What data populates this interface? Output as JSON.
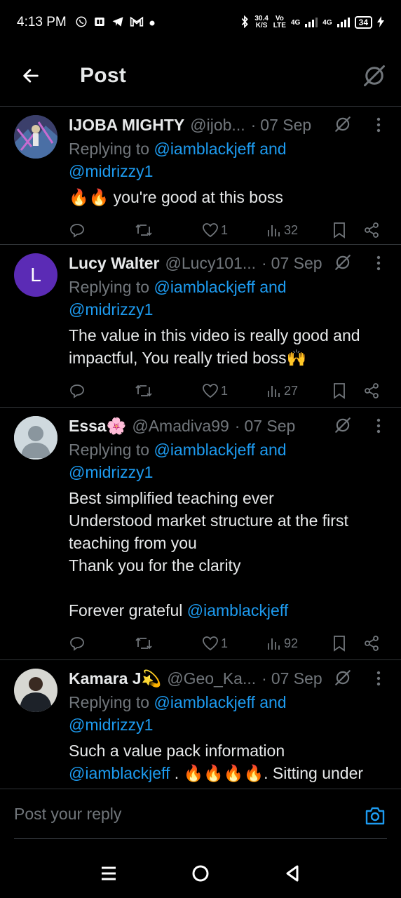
{
  "status_bar": {
    "time": "4:13 PM",
    "net_speed": "30.4",
    "net_unit": "K/S",
    "volte": "Vo",
    "volte2": "LTE",
    "network1": "4G",
    "network2": "4G",
    "battery": "34"
  },
  "header": {
    "title": "Post"
  },
  "tweets": [
    {
      "name": "IJOBA MIGHTY",
      "handle": "@ijob...",
      "date": "07 Sep",
      "reply_prefix": "Replying to ",
      "reply_targets": "@iamblackjeff and",
      "reply_targets2": "@midrizzy1",
      "text": "🔥🔥 you're good at this boss",
      "likes": "1",
      "views": "32",
      "avatar_color": "#2a3d4f"
    },
    {
      "name": "Lucy Walter",
      "handle": "@Lucy101...",
      "date": "07 Sep",
      "reply_prefix": "Replying to ",
      "reply_targets": "@iamblackjeff and",
      "reply_targets2": "@midrizzy1",
      "text": "The value in this video is really good and impactful, You really tried boss🙌",
      "likes": "1",
      "views": "27",
      "avatar_letter": "L",
      "avatar_color": "#5b2bb5"
    },
    {
      "name": "Essa🌸",
      "handle": "@Amadiva99",
      "date": "07 Sep",
      "reply_prefix": "Replying to ",
      "reply_targets": "@iamblackjeff and",
      "reply_targets2": "@midrizzy1",
      "text": "Best simplified teaching ever\nUnderstood market structure at the first teaching from you\nThank you for the clarity\n\nForever grateful ",
      "text_mention": "@iamblackjeff",
      "likes": "1",
      "views": "92",
      "avatar_color": "#cfd9de"
    },
    {
      "name": "Kamara J💫",
      "handle": "@Geo_Ka...",
      "date": "07 Sep",
      "reply_prefix": "Replying to ",
      "reply_targets": "@iamblackjeff and",
      "reply_targets2": "@midrizzy1",
      "text_line1": "Such a value pack information",
      "text_mention": "@iamblackjeff",
      "text_rest": " . 🔥🔥🔥🔥. Sitting under",
      "avatar_color": "#3a3a3a"
    }
  ],
  "reply_bar": {
    "placeholder": "Post your reply"
  },
  "colors": {
    "accent": "#1d9bf0",
    "muted": "#71767b",
    "background": "#000000",
    "divider": "#2f3336"
  }
}
